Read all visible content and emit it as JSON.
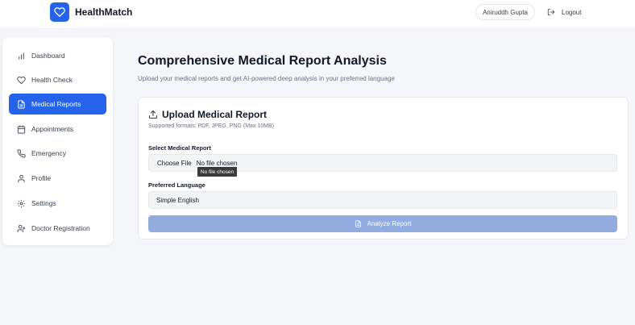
{
  "app": {
    "name": "HealthMatch",
    "accent": "#2563eb"
  },
  "header": {
    "user_name": "Aniruddh Gupta",
    "logout_label": "Logout"
  },
  "sidebar": {
    "items": [
      {
        "label": "Dashboard",
        "icon": "bar-chart-icon",
        "active": false
      },
      {
        "label": "Health Check",
        "icon": "heart-icon",
        "active": false
      },
      {
        "label": "Medical Reports",
        "icon": "document-icon",
        "active": true
      },
      {
        "label": "Appointments",
        "icon": "calendar-icon",
        "active": false
      },
      {
        "label": "Emergency",
        "icon": "phone-icon",
        "active": false
      },
      {
        "label": "Profile",
        "icon": "user-icon",
        "active": false
      },
      {
        "label": "Settings",
        "icon": "gear-icon",
        "active": false
      },
      {
        "label": "Doctor Registration",
        "icon": "user-plus-icon",
        "active": false
      }
    ]
  },
  "main": {
    "title": "Comprehensive Medical Report Analysis",
    "subtitle": "Upload your medical reports and get AI-powered deep analysis in your preferred language",
    "card": {
      "title": "Upload Medical Report",
      "formats": "Supported formats: PDF, JPEG, PNG (Max 10MB)",
      "file_label": "Select Medical Report",
      "choose_file_label": "Choose File",
      "no_file_text": "No file chosen",
      "tooltip": "No file chosen",
      "language_label": "Preferred Language",
      "language_value": "Simple English",
      "analyze_label": "Analyze Report"
    }
  }
}
